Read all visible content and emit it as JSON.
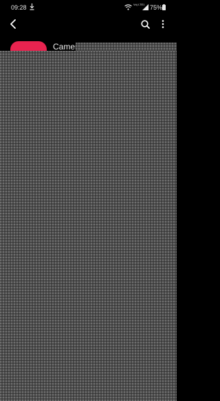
{
  "status_bar": {
    "time": "09:28",
    "network_label": "Vo) LTE1",
    "battery_percent": "75%",
    "icons": [
      "download-icon",
      "wifi-icon",
      "signal-icon",
      "battery-icon"
    ]
  },
  "app_bar": {
    "back_icon": "back-arrow-icon",
    "search_icon": "search-icon",
    "more_icon": "more-vertical-icon"
  },
  "app_header": {
    "name": "Camer",
    "icon": "camera-app-icon",
    "icon_color": "#e8234f"
  },
  "colors": {
    "background": "#000000",
    "overlay": "#4d4d4d"
  }
}
